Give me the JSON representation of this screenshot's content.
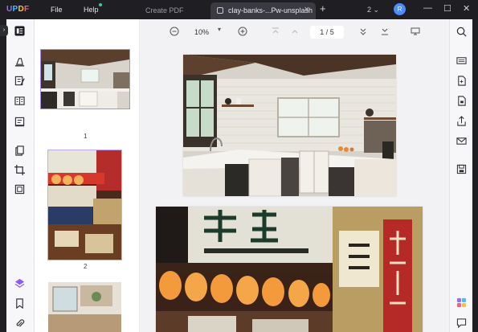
{
  "titlebar": {
    "logo": {
      "u": "U",
      "p": "P",
      "d": "D",
      "f": "F"
    },
    "menu_file": "File",
    "menu_help": "Help",
    "tab_create": "Create PDF",
    "tab_active_title": "clay-banks-...Pw-unsplash",
    "tab_close": "×",
    "new_tab": "+",
    "tab_count": "2",
    "tab_count_chevron": "⌄",
    "avatar": "R",
    "minimize": "—",
    "maximize": "☐",
    "close": "✕"
  },
  "viewer": {
    "zoom": "10%",
    "current_page": "1",
    "total_pages": "5",
    "page_sep": "/"
  },
  "thumbnails": [
    {
      "label": "1"
    },
    {
      "label": "2"
    }
  ],
  "colors": {
    "accent": "#9b6cff",
    "selection": "#a98cf0",
    "titlebar": "#1e1e23"
  }
}
